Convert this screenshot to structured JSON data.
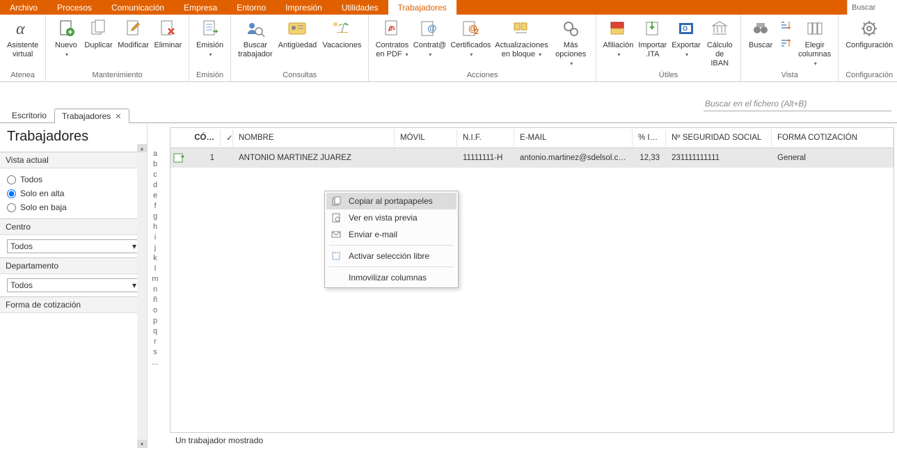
{
  "menubar": {
    "items": [
      "Archivo",
      "Procesos",
      "Comunicación",
      "Empresa",
      "Entorno",
      "Impresión",
      "Utilidades",
      "Trabajadores"
    ],
    "active_index": 7,
    "search_placeholder": "Buscar"
  },
  "ribbon": {
    "groups": [
      {
        "label": "Atenea",
        "items": [
          {
            "label": "Asistente\nvirtual",
            "icon": "alpha"
          }
        ]
      },
      {
        "label": "Mantenimiento",
        "items": [
          {
            "label": "Nuevo",
            "icon": "doc-plus",
            "caret": true
          },
          {
            "label": "Duplicar",
            "icon": "doc-dup"
          },
          {
            "label": "Modificar",
            "icon": "doc-edit"
          },
          {
            "label": "Eliminar",
            "icon": "doc-del"
          }
        ]
      },
      {
        "label": "Emisión",
        "items": [
          {
            "label": "Emisión",
            "icon": "doc-arrow",
            "caret": true
          }
        ]
      },
      {
        "label": "Consultas",
        "items": [
          {
            "label": "Buscar\ntrabajador",
            "icon": "people-search"
          },
          {
            "label": "Antigüedad",
            "icon": "id-card"
          },
          {
            "label": "Vacaciones",
            "icon": "beach"
          }
        ]
      },
      {
        "label": "Acciones",
        "items": [
          {
            "label": "Contratos\nen PDF",
            "icon": "pdf",
            "caret": true
          },
          {
            "label": "Contrat@",
            "icon": "contrat",
            "caret": true
          },
          {
            "label": "Certificados",
            "icon": "cert",
            "caret": true
          },
          {
            "label": "Actualizaciones\nen bloque",
            "icon": "block",
            "caret": true
          },
          {
            "label": "Más\nopciones",
            "icon": "gears",
            "caret": true
          }
        ]
      },
      {
        "label": "Útiles",
        "items": [
          {
            "label": "Afiliación",
            "icon": "affil",
            "caret": true
          },
          {
            "label": "Importar\n.ITA",
            "icon": "import"
          },
          {
            "label": "Exportar",
            "icon": "export",
            "caret": true
          },
          {
            "label": "Cálculo\nde IBAN",
            "icon": "bank"
          }
        ]
      },
      {
        "label": "Vista",
        "items": [
          {
            "label": "Buscar",
            "icon": "binoc"
          },
          {
            "label": "",
            "icon": "sort-small",
            "small": true
          },
          {
            "label": "Elegir\ncolumnas",
            "icon": "columns",
            "caret": true
          }
        ]
      },
      {
        "label": "Configuración",
        "items": [
          {
            "label": "Configuración",
            "icon": "gear"
          }
        ]
      }
    ]
  },
  "doc_tabs": {
    "items": [
      "Escritorio",
      "Trabajadores"
    ],
    "active_index": 1
  },
  "sidebar": {
    "title": "Trabajadores",
    "vista_label": "Vista actual",
    "radios": [
      {
        "label": "Todos",
        "checked": false
      },
      {
        "label": "Solo en alta",
        "checked": true
      },
      {
        "label": "Solo en baja",
        "checked": false
      }
    ],
    "centro_label": "Centro",
    "centro_value": "Todos",
    "depto_label": "Departamento",
    "depto_value": "Todos",
    "forma_label": "Forma de cotización"
  },
  "alpha_letters": [
    "a",
    "b",
    "c",
    "d",
    "e",
    "f",
    "g",
    "h",
    "i",
    "j",
    "k",
    "l",
    "m",
    "n",
    "ñ",
    "o",
    "p",
    "q",
    "r",
    "s",
    "..."
  ],
  "grid": {
    "search_placeholder": "Buscar en el fichero (Alt+B)",
    "columns": {
      "code": "CÓ…",
      "name": "NOMBRE",
      "movil": "MÓVIL",
      "nif": "N.I.F.",
      "email": "E-MAIL",
      "ir": "% I.R…",
      "ss": "Nº SEGURIDAD SOCIAL",
      "forma": "FORMA COTIZACIÓN"
    },
    "rows": [
      {
        "code": "1",
        "name": "ANTONIO MARTINEZ JUAREZ",
        "movil": "",
        "nif": "11111111-H",
        "email": "antonio.martinez@sdelsol.c…",
        "ir": "12,33",
        "ss": "231111111111",
        "forma": "General"
      }
    ],
    "status": "Un trabajador mostrado"
  },
  "context_menu": {
    "items": [
      {
        "label": "Copiar al portapapeles",
        "icon": "copy",
        "hover": true
      },
      {
        "label": "Ver en vista previa",
        "icon": "preview"
      },
      {
        "label": "Enviar e-mail",
        "icon": "mail"
      },
      {
        "sep": true
      },
      {
        "label": "Activar selección libre",
        "icon": "select"
      },
      {
        "sep": true
      },
      {
        "label": "Inmovilizar columnas",
        "icon": ""
      }
    ]
  }
}
